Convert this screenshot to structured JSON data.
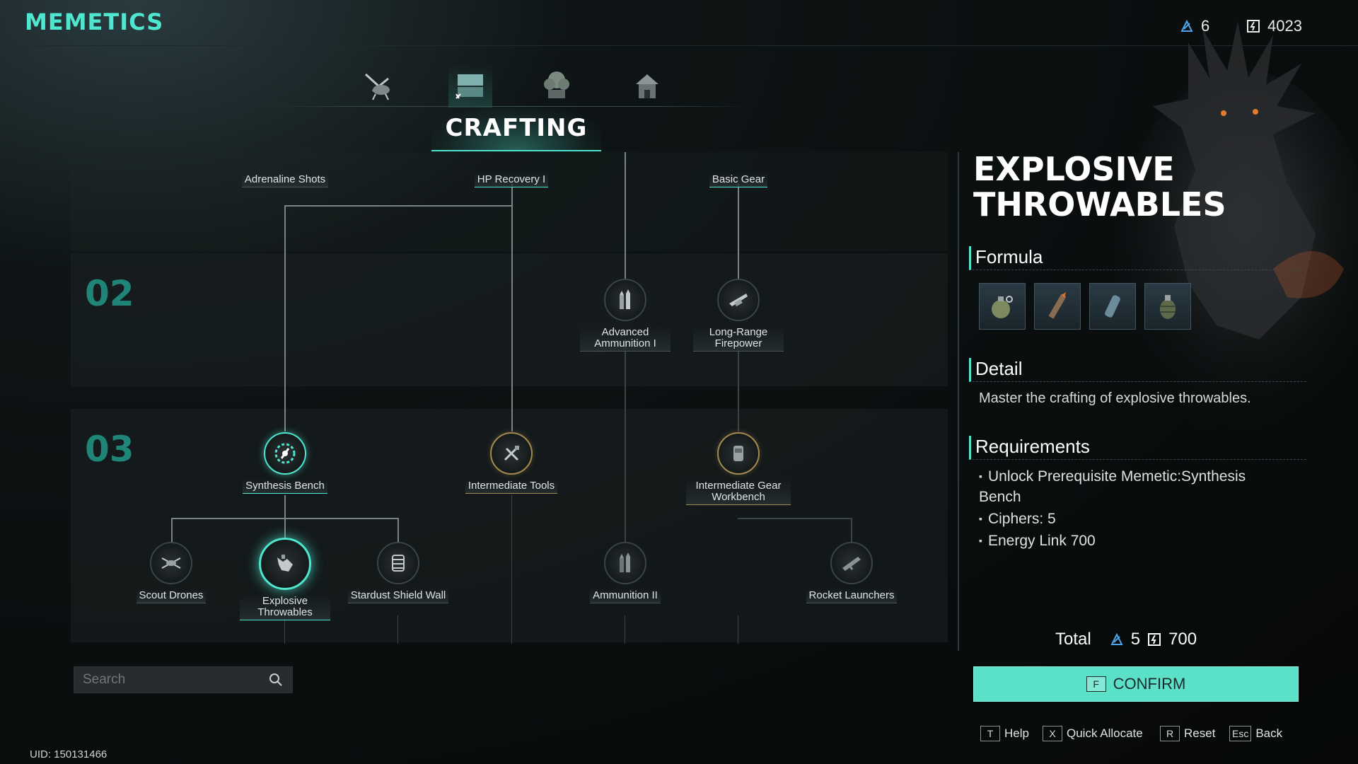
{
  "header": {
    "title": "MEMETICS"
  },
  "resources": {
    "ciphers": "6",
    "energy_link": "4023"
  },
  "tabs": [
    {
      "icon": "drone-icon",
      "active": false
    },
    {
      "icon": "workbench-icon",
      "active": true
    },
    {
      "icon": "tree-icon",
      "active": false
    },
    {
      "icon": "house-icon",
      "active": false
    }
  ],
  "category": {
    "title": "CRAFTING"
  },
  "tiers": {
    "t2": "02",
    "t3": "03"
  },
  "nodes": {
    "adrenaline_shots": "Adrenaline Shots",
    "hp_recovery_1": "HP Recovery I",
    "basic_gear": "Basic Gear",
    "advanced_ammunition_1": "Advanced Ammunition I",
    "long_range_firepower": "Long-Range Firepower",
    "synthesis_bench": "Synthesis Bench",
    "intermediate_tools": "Intermediate Tools",
    "intermediate_gear_workbench": "Intermediate Gear Workbench",
    "scout_drones": "Scout Drones",
    "explosive_throwables": "Explosive Throwables",
    "stardust_shield_wall": "Stardust Shield Wall",
    "ammunition_2": "Ammunition II",
    "rocket_launchers": "Rocket Launchers"
  },
  "search": {
    "placeholder": "Search"
  },
  "uid": "UID: 150131466",
  "detail": {
    "title_line1": "EXPLOSIVE",
    "title_line2": "THROWABLES",
    "formula_label": "Formula",
    "formula_items": [
      "grenade-icon",
      "flare-icon",
      "canister-icon",
      "frag-grenade-icon"
    ],
    "detail_label": "Detail",
    "detail_text": "Master the crafting of explosive throwables.",
    "requirements_label": "Requirements",
    "requirements": [
      "Unlock Prerequisite Memetic:Synthesis Bench",
      "Ciphers:  5",
      "Energy Link 700"
    ],
    "total_label": "Total",
    "total_ciphers": "5",
    "total_energy": "700",
    "confirm_key": "F",
    "confirm_label": "CONFIRM"
  },
  "hints": [
    {
      "key": "T",
      "label": "Help"
    },
    {
      "key": "X",
      "label": "Quick Allocate"
    },
    {
      "key": "R",
      "label": "Reset"
    },
    {
      "key": "Esc",
      "label": "Back"
    }
  ],
  "colors": {
    "accent": "#4fe6cf",
    "gold": "#a38a4e",
    "confirm_bg": "#5ce1c9"
  }
}
